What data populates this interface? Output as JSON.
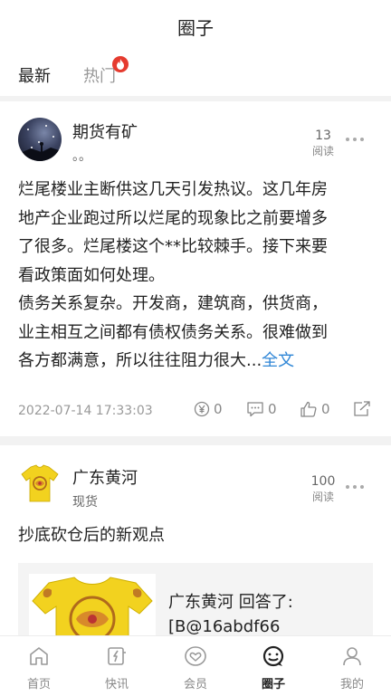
{
  "header": {
    "title": "圈子"
  },
  "tabs": {
    "latest": "最新",
    "hot": "热门"
  },
  "posts": [
    {
      "author": "期货有矿",
      "subtitle": "。。",
      "read_count": "13",
      "read_label": "阅读",
      "text_lines": [
        "烂尾楼业主断供这几天引发热议。这几年房",
        "地产企业跑过所以烂尾的现象比之前要增多",
        "了很多。烂尾楼这个**比较棘手。接下来要",
        "看政策面如何处理。",
        "债务关系复杂。开发商，建筑商，供货商，",
        "业主相互之间都有债权债务关系。很难做到"
      ],
      "last_line": "各方都满意，所以往往阻力很大...",
      "full_text_link": "全文",
      "date": "2022-07-14 17:33:03",
      "reward_count": "0",
      "comment_count": "0",
      "like_count": "0"
    },
    {
      "author": "广东黄河",
      "subtitle": "现货",
      "read_count": "100",
      "read_label": "阅读",
      "text": "抄底砍仓后的新观点",
      "quote_lines": [
        "广东黄河 回答了:",
        "[B@16abdf66"
      ]
    }
  ],
  "nav": [
    {
      "label": "首页",
      "icon": "home-icon"
    },
    {
      "label": "快讯",
      "icon": "newsflash-icon"
    },
    {
      "label": "会员",
      "icon": "vip-heart-icon"
    },
    {
      "label": "圈子",
      "icon": "circle-chat-icon",
      "active": true
    },
    {
      "label": "我的",
      "icon": "profile-icon"
    }
  ],
  "colors": {
    "accent_link": "#2f86d6",
    "badge_red": "#e53b2f",
    "shirt_yellow": "#f2d21f"
  }
}
